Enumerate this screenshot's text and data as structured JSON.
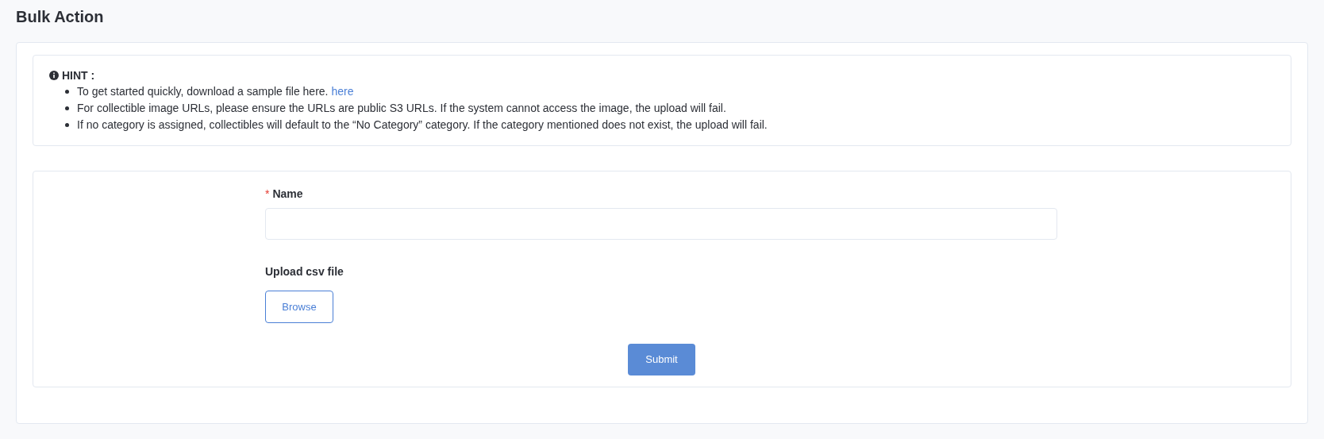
{
  "page": {
    "title": "Bulk Action"
  },
  "hint": {
    "title": "HINT :",
    "items": [
      {
        "text": "To get started quickly, download a sample file here.",
        "link": "here"
      },
      {
        "text": "For collectible image URLs, please ensure the URLs are public S3 URLs. If the system cannot access the image, the upload will fail."
      },
      {
        "text": "If no category is assigned, collectibles will default to the “No Category” category. If the category mentioned does not exist, the upload will fail."
      }
    ]
  },
  "form": {
    "name_field": {
      "label": "Name",
      "required": true,
      "required_mark": "*"
    },
    "upload": {
      "label": "Upload csv file",
      "button": "Browse"
    },
    "submit": "Submit"
  }
}
